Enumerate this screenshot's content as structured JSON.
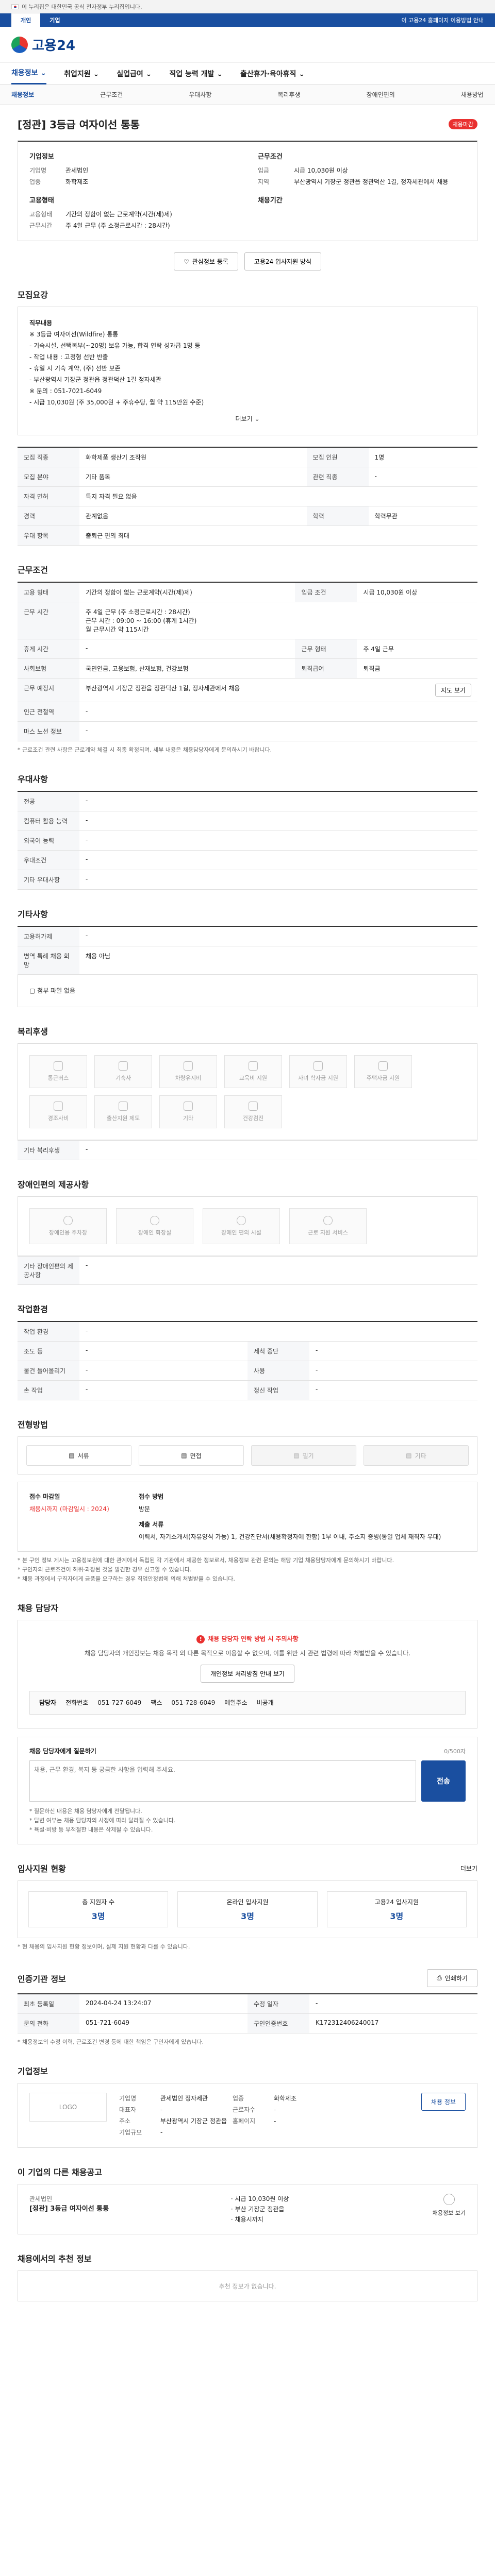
{
  "gov_banner": {
    "text": "이 누리집은 대한민국 공식 전자정부 누리집입니다."
  },
  "topbar": {
    "tab_personal": "개인",
    "tab_company": "기업",
    "right_text": "이 고용24 홈페이지 이용방법 안내"
  },
  "logo": {
    "text": "고용24"
  },
  "gnb": [
    "채용정보",
    "취업지원",
    "실업급여",
    "직업 능력 개발",
    "출산휴가·육아휴직"
  ],
  "subnav": [
    "채용정보",
    "근무조건",
    "우대사항",
    "복리후생",
    "장애인편의",
    "채용방법"
  ],
  "job": {
    "title": "[정관] 3등급 여자이선 통통",
    "status": "채용마감",
    "summary_label_company": "기업정보",
    "summary_label_conditions": "근무조건",
    "company_k1": "기업명",
    "company_v1": "관세법인",
    "company_k2": "업종",
    "company_v2": "화학제조",
    "conditions_k1": "임금",
    "conditions_v1": "시급 10,030원 이상",
    "conditions_k2": "지역",
    "conditions_v2": "부산광역시 기장군 정관읍 정관덕산 1길, 정자세관에서 채용",
    "requirement_label": "고용형태",
    "requirement_k1": "고용형태",
    "requirement_v1": "기간의 정함이 없는 근로계약(시간(제)제)",
    "requirement_k2": "근무시간",
    "requirement_v2": "주 4일 근무 (주 소정근로시간 : 28시간)",
    "apply_label": "채용기간",
    "btn_scrap": "관심정보 등록",
    "btn_interest": "고용24 입사지원 방식"
  },
  "recruit_summary": {
    "title": "모집요강",
    "lines": [
      "직무내용",
      "※ 3등급 여자이선(Wildfire) 통통",
      "- 기숙시설, 선택복부(~20명) 보유 가능, 합격 연락 성과급 1명 등",
      "- 작업 내용 : 고정형 선반 반출",
      "- 휴일 시 기숙 계약, (주) 선반 보존",
      "- 부산광역시 기장군 정관읍 정관덕산 1길 정자세관",
      "※ 문의 : 051-7021-6049",
      "- 시급 10,030원 (주 35,000원 + 주휴수당, 월 약 115만원 수준)"
    ],
    "more": "더보기"
  },
  "recruit_table": {
    "rows": [
      {
        "k": "모집 직종",
        "v": "화학제품 생산기 조작원",
        "k2": "모집 인원",
        "v2": "1명"
      },
      {
        "k": "모집 분야",
        "v": "기타 품목",
        "k2": "관련 직종",
        "v2": "-"
      },
      {
        "k": "자격 면허",
        "v": "특지 자격 필요 없음",
        "k2": "",
        "v2": ""
      },
      {
        "k": "경력",
        "v": "관계없음",
        "k2": "학력",
        "v2": "학력무관"
      },
      {
        "k": "우대 항목",
        "v": "출퇴근 편의 최대",
        "k2": "",
        "v2": ""
      }
    ]
  },
  "work_conditions": {
    "title": "근무조건",
    "rows": [
      {
        "k": "고용 형태",
        "v": "기간의 정함이 없는 근로계약(시간(제)제)",
        "k2": "임금 조건",
        "v2": "시급 10,030원 이상"
      },
      {
        "k": "근무 시간",
        "v": "주 4일 근무 (주 소정근로시간 : 28시간)\n근무 시간 : 09:00 ~ 16:00 (휴게 1시간)\n월 근무시간 약 115시간",
        "k2": "",
        "v2": ""
      },
      {
        "k": "휴게 시간",
        "v": "-",
        "k2": "근무 형태",
        "v2": "주 4일 근무"
      },
      {
        "k": "사회보험",
        "v": "국민연금, 고용보험, 산재보험, 건강보험",
        "k2": "퇴직급여",
        "v2": "퇴직금"
      },
      {
        "k": "근무 예정지",
        "v": "부산광역시 기장군 정관읍 정관덕산 1길, 정자세관에서 채용",
        "k2": "",
        "v2": ""
      },
      {
        "k": "인근 전철역",
        "v": "-",
        "k2": "",
        "v2": ""
      },
      {
        "k": "마스 노선 정보",
        "v": "-",
        "k2": "",
        "v2": ""
      }
    ],
    "map_button": "지도 보기",
    "note": "* 근로조건 관련 사항은 근로계약 체결 시 최종 확정되며, 세부 내용은 채용담당자에게 문의하시기 바랍니다."
  },
  "preferred": {
    "title": "우대사항",
    "rows": [
      {
        "k": "전공",
        "v": "-"
      },
      {
        "k": "컴퓨터 활용 능력",
        "v": "-"
      },
      {
        "k": "외국어 능력",
        "v": "-"
      },
      {
        "k": "우대조건",
        "v": "-"
      },
      {
        "k": "기타 우대사항",
        "v": "-"
      }
    ]
  },
  "other_conditions": {
    "title": "기타사항",
    "rows": [
      {
        "k": "고용허가제",
        "v": "-"
      },
      {
        "k": "병역 특례 채용 희망",
        "v": "채용 아님"
      }
    ],
    "attach": "첨부 파일 없음"
  },
  "welfare": {
    "title": "복리후생",
    "items": [
      "통근버스",
      "기숙사",
      "차량유지비",
      "교육비 지원",
      "자녀 학자금 지원",
      "주택자금 지원",
      "경조사비",
      "출산지원 제도",
      "기타",
      "건강검진"
    ],
    "other_label": "기타 복리후생",
    "other_value": "-"
  },
  "disability": {
    "title": "장애인편의 제공사항",
    "items": [
      "장애인용 주차장",
      "장애인 화장실",
      "장애인 편의 시설",
      "근로 지원 서비스"
    ],
    "other_label": "기타 장애인편의 제공사항",
    "other_value": "-"
  },
  "work_environment": {
    "title": "작업환경",
    "rows": [
      {
        "k": "작업 환경",
        "v": "-",
        "k2": "",
        "v2": ""
      },
      {
        "k": "조도 등",
        "v": "-",
        "k2": "세척 중단",
        "v2": "-"
      },
      {
        "k": "물건 들어올리기",
        "v": "-",
        "k2": "사용",
        "v2": "-"
      },
      {
        "k": "손 작업",
        "v": "-",
        "k2": "정신 작업",
        "v2": "-"
      }
    ]
  },
  "hiring_method": {
    "title": "전형방법",
    "methods": [
      {
        "label": "서류",
        "on": true
      },
      {
        "label": "면접",
        "on": true
      },
      {
        "label": "필기",
        "on": false
      },
      {
        "label": "기타",
        "on": false
      }
    ],
    "apply_period_label": "접수 마감일",
    "apply_period_value": "채용시까지 (마감일시 : 2024)",
    "apply_method_label": "접수 방법",
    "apply_method_value": "방문",
    "docs_label": "제출 서류",
    "docs_value": "이력서, 자기소개서(자유양식 가능) 1, 건강진단서(채용확정자에 한함) 1부 이내, 주소지 증빙(동일 업체 재직자 우대)",
    "notes": [
      "* 본 구인 정보 게시는 고용정보원에 대한 관계에서 독립된 각 기관에서 제공한 정보로서, 채용정보 관련 문의는 해당 기업 채용담당자에게 문의하시기 바랍니다.",
      "* 구인자의 근로조건이 허위·과장된 것을 발견한 경우 신고할 수 있습니다.",
      "* 채용 과정에서 구직자에게 금품을 요구하는 경우 직업안정법에 의해 처벌받을 수 있습니다."
    ]
  },
  "contact": {
    "title": "채용 담당자",
    "warn": "채용 담당자 연락 방법 시 주의사항",
    "desc": "채용 담당자의 개인정보는 채용 목적 외 다른 목적으로 이용할 수 없으며, 이를 위반 시 관련 법령에 따라 처벌받을 수 있습니다.",
    "inquiry_button": "개인정보 처리방침 안내 보기",
    "name_label": "담당자",
    "phone_label": "전화번호",
    "phone_value": "051-727-6049",
    "fax_label": "팩스",
    "fax_value": "051-728-6049",
    "mail_label": "메일주소",
    "mail_value": "비공개",
    "qa_title": "채용 담당자에게 질문하기",
    "qa_placeholder": "채용, 근무 환경, 복지 등 궁금한 사항을 입력해 주세요.",
    "qa_button": "전송",
    "qa_count": "0/500자",
    "qa_notes": [
      "* 질문하신 내용은 채용 담당자에게 전달됩니다.",
      "* 답변 여부는 채용 담당자의 사정에 따라 달라질 수 있습니다.",
      "* 욕설·비방 등 부적절한 내용은 삭제될 수 있습니다."
    ]
  },
  "applicants": {
    "title": "입사지원 현황",
    "more": "더보기",
    "stats": [
      {
        "label": "총 지원자 수",
        "value": "3명"
      },
      {
        "label": "온라인 입사지원",
        "value": "3명"
      },
      {
        "label": "고용24 입사지원",
        "value": "3명"
      }
    ],
    "note": "* 현 채용의 입사지원 현황 정보이며, 실제 지원 현황과 다를 수 있습니다."
  },
  "job_info": {
    "title": "인증기관 정보",
    "print_button": "인쇄하기",
    "rows": [
      {
        "k": "최초 등록일",
        "v": "2024-04-24 13:24:07",
        "k2": "수정 일자",
        "v2": "-"
      },
      {
        "k": "문의 전화",
        "v": "051-721-6049",
        "k2": "구인인증번호",
        "v2": "K172312406240017"
      }
    ],
    "note": "* 채용정보의 수정 이력, 근로조건 변경 등에 대한 책임은 구인자에게 있습니다."
  },
  "company": {
    "title": "기업정보",
    "logo": "LOGO",
    "fields": [
      {
        "k": "기업명",
        "v": "관세법인 정자세관"
      },
      {
        "k": "업종",
        "v": "화학제조"
      },
      {
        "k": "대표자",
        "v": "-"
      },
      {
        "k": "근로자수",
        "v": "-"
      },
      {
        "k": "주소",
        "v": "부산광역시 기장군 정관읍"
      },
      {
        "k": "홈페이지",
        "v": "-"
      },
      {
        "k": "기업규모",
        "v": "-"
      }
    ],
    "detail_button": "채용 정보"
  },
  "other_jobs": {
    "title": "이 기업의 다른 채용공고",
    "company": "관세법인",
    "job_title": "[정관] 3등급 여자이선 통통",
    "meta": [
      "시급 10,030원 이상",
      "부산 기장군 정관읍",
      "채용시까지"
    ],
    "right_label": "채용정보 보기"
  },
  "recommend": {
    "title": "채용에서의 추천 정보",
    "empty": "추천 정보가 없습니다."
  }
}
